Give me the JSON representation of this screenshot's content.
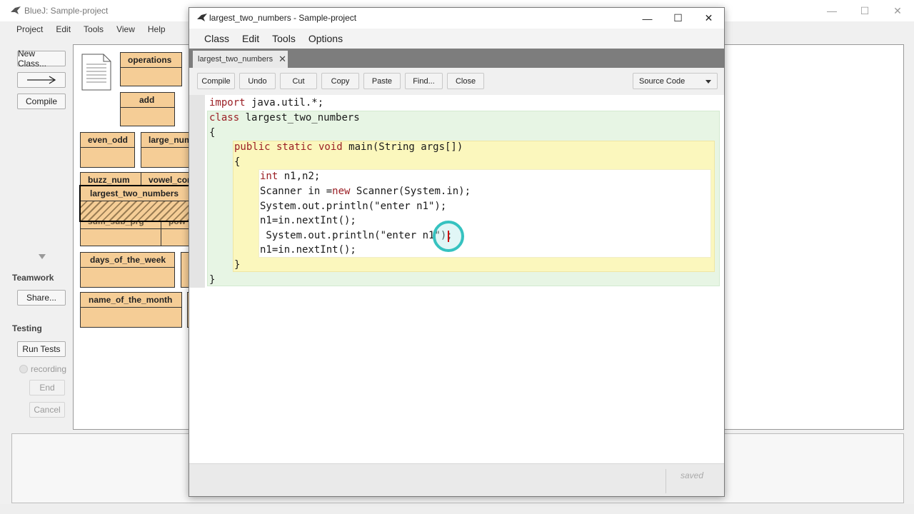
{
  "main_window": {
    "title": "BlueJ: Sample-project",
    "window_controls": [
      "—",
      "☐",
      "✕"
    ],
    "menu": [
      "Project",
      "Edit",
      "Tools",
      "View",
      "Help"
    ],
    "side_buttons": {
      "new_class": "New Class...",
      "arrow": "→",
      "compile": "Compile",
      "share": "Share...",
      "run_tests": "Run Tests",
      "end": "End",
      "cancel": "Cancel"
    },
    "teamwork_heading": "Teamwork",
    "testing_heading": "Testing",
    "recording_label": "recording",
    "classes": [
      "operations",
      "add",
      "even_odd",
      "large_num",
      "buzz_num",
      "vowel_con",
      "largest_two_numbers",
      "sum_sub_prg",
      "pow",
      "days_of_the_week",
      "name_of_the_month"
    ]
  },
  "editor": {
    "title": "largest_two_numbers - Sample-project",
    "window_controls": [
      "—",
      "☐",
      "✕"
    ],
    "menu": [
      "Class",
      "Edit",
      "Tools",
      "Options"
    ],
    "tab_label": "largest_two_numbers",
    "tab_close": "✕",
    "toolbar": [
      "Compile",
      "Undo",
      "Cut",
      "Copy",
      "Paste",
      "Find...",
      "Close"
    ],
    "view_select": "Source Code",
    "code_lines": [
      {
        "kw": "import",
        "rest": " java.util.*;"
      },
      {
        "kw": "class",
        "rest": " largest_two_numbers"
      },
      {
        "kw": "",
        "rest": "{"
      },
      {
        "kw": "public static void",
        "rest": " main(String args[])"
      },
      {
        "kw": "",
        "rest": "{"
      },
      {
        "kw": "int",
        "rest": " n1,n2;"
      },
      {
        "kw": "",
        "rest": "Scanner in ="
      },
      {
        "kw": "new",
        "rest": " Scanner(System.in);"
      },
      {
        "kw": "",
        "rest": "System.out.println(\"enter n1\");"
      },
      {
        "kw": "",
        "rest": "n1=in.nextInt();"
      },
      {
        "kw": "",
        "rest": " System.out.println(\"enter n1\");"
      },
      {
        "kw": "",
        "rest": "n1=in.nextInt();"
      },
      {
        "kw": "",
        "rest": "}"
      },
      {
        "kw": "",
        "rest": "}"
      }
    ],
    "status": "saved"
  },
  "colors": {
    "class_box": "#f5cd96",
    "keyword": "#9b1f25",
    "class_scope": "#e7f5e4",
    "method_scope": "#fbf7bd",
    "click_ring": "#36c2c0"
  }
}
